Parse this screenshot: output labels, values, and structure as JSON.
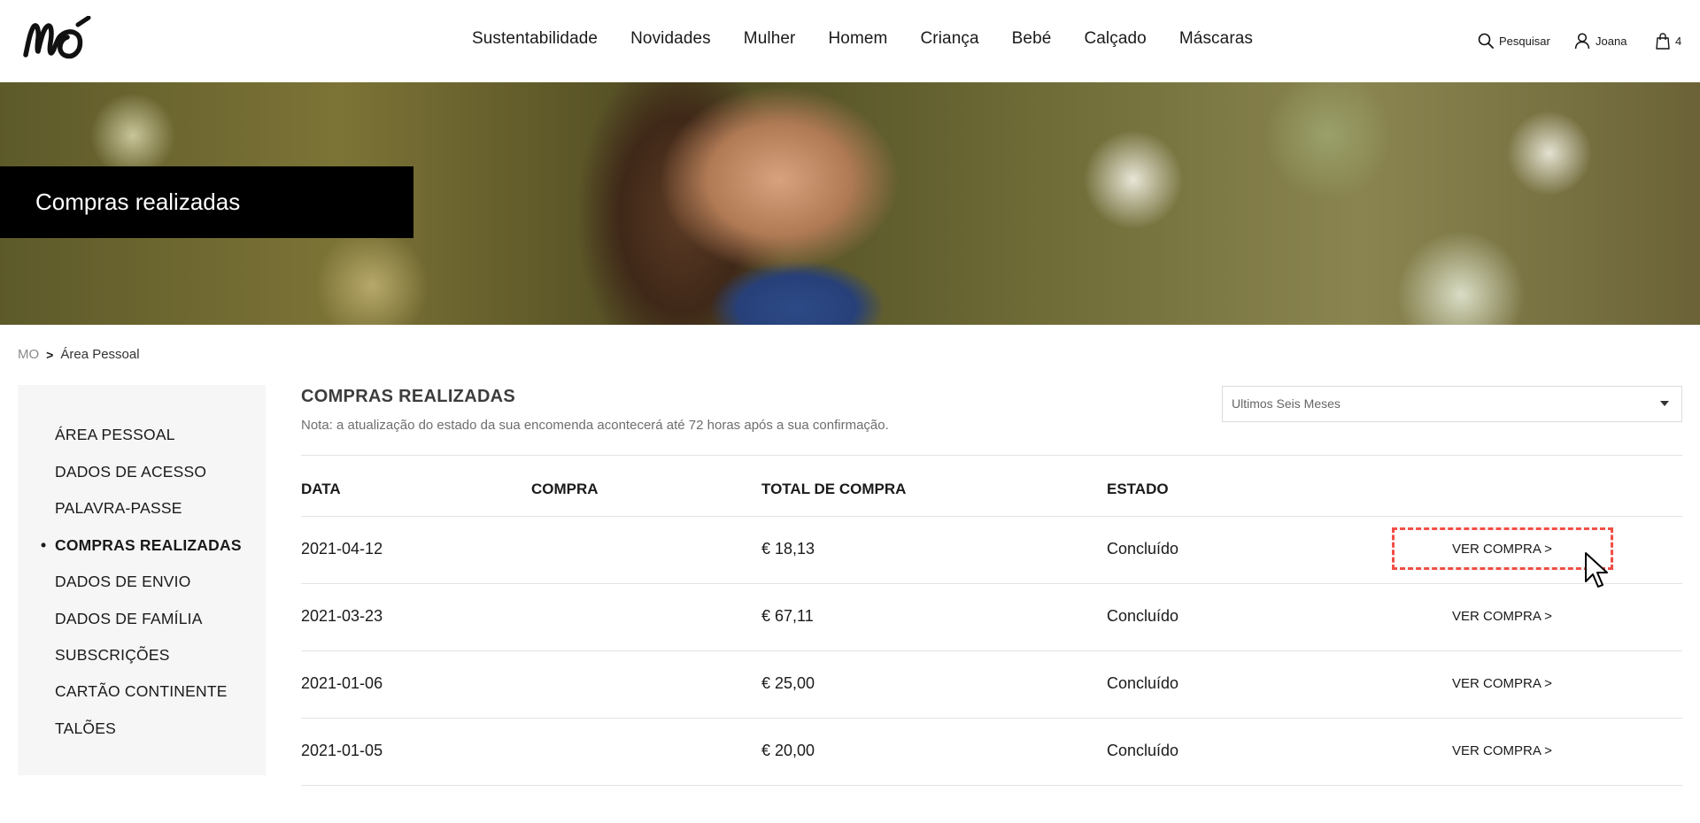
{
  "brand": {
    "logo_text": "MO"
  },
  "nav": {
    "items": [
      "Sustentabilidade",
      "Novidades",
      "Mulher",
      "Homem",
      "Criança",
      "Bebé",
      "Calçado",
      "Máscaras"
    ]
  },
  "utilities": {
    "search_label": "Pesquisar",
    "user_label": "Joana",
    "cart_count": "4"
  },
  "hero": {
    "title": "Compras realizadas"
  },
  "breadcrumb": {
    "home": "MO",
    "separator": ">",
    "current": "Área Pessoal"
  },
  "sidebar": {
    "items": [
      {
        "label": "ÁREA PESSOAL",
        "active": false
      },
      {
        "label": "DADOS DE ACESSO",
        "active": false
      },
      {
        "label": "PALAVRA-PASSE",
        "active": false
      },
      {
        "label": "COMPRAS REALIZADAS",
        "active": true
      },
      {
        "label": "DADOS DE ENVIO",
        "active": false
      },
      {
        "label": "DADOS DE FAMÍLIA",
        "active": false
      },
      {
        "label": "SUBSCRIÇÕES",
        "active": false
      },
      {
        "label": "CARTÃO CONTINENTE",
        "active": false
      },
      {
        "label": "TALÕES",
        "active": false
      }
    ],
    "active_marker": "•"
  },
  "main": {
    "title": "COMPRAS REALIZADAS",
    "note": "Nota: a atualização do estado da sua encomenda acontecerá até 72 horas após a sua confirmação.",
    "filter": {
      "selected": "Ultimos Seis Meses"
    },
    "table": {
      "headers": [
        "DATA",
        "COMPRA",
        "TOTAL DE COMPRA",
        "ESTADO"
      ],
      "rows": [
        {
          "date": "2021-04-12",
          "purchase": "",
          "total": "€ 18,13",
          "status": "Concluído",
          "action": "VER COMPRA >"
        },
        {
          "date": "2021-03-23",
          "purchase": "",
          "total": "€ 67,11",
          "status": "Concluído",
          "action": "VER COMPRA >"
        },
        {
          "date": "2021-01-06",
          "purchase": "",
          "total": "€ 25,00",
          "status": "Concluído",
          "action": "VER COMPRA >"
        },
        {
          "date": "2021-01-05",
          "purchase": "",
          "total": "€ 20,00",
          "status": "Concluído",
          "action": "VER COMPRA >"
        }
      ]
    }
  },
  "colors": {
    "accent_highlight": "#f04e45",
    "sidebar_bg": "#f6f6f6",
    "hero_label_bg": "#000000"
  }
}
